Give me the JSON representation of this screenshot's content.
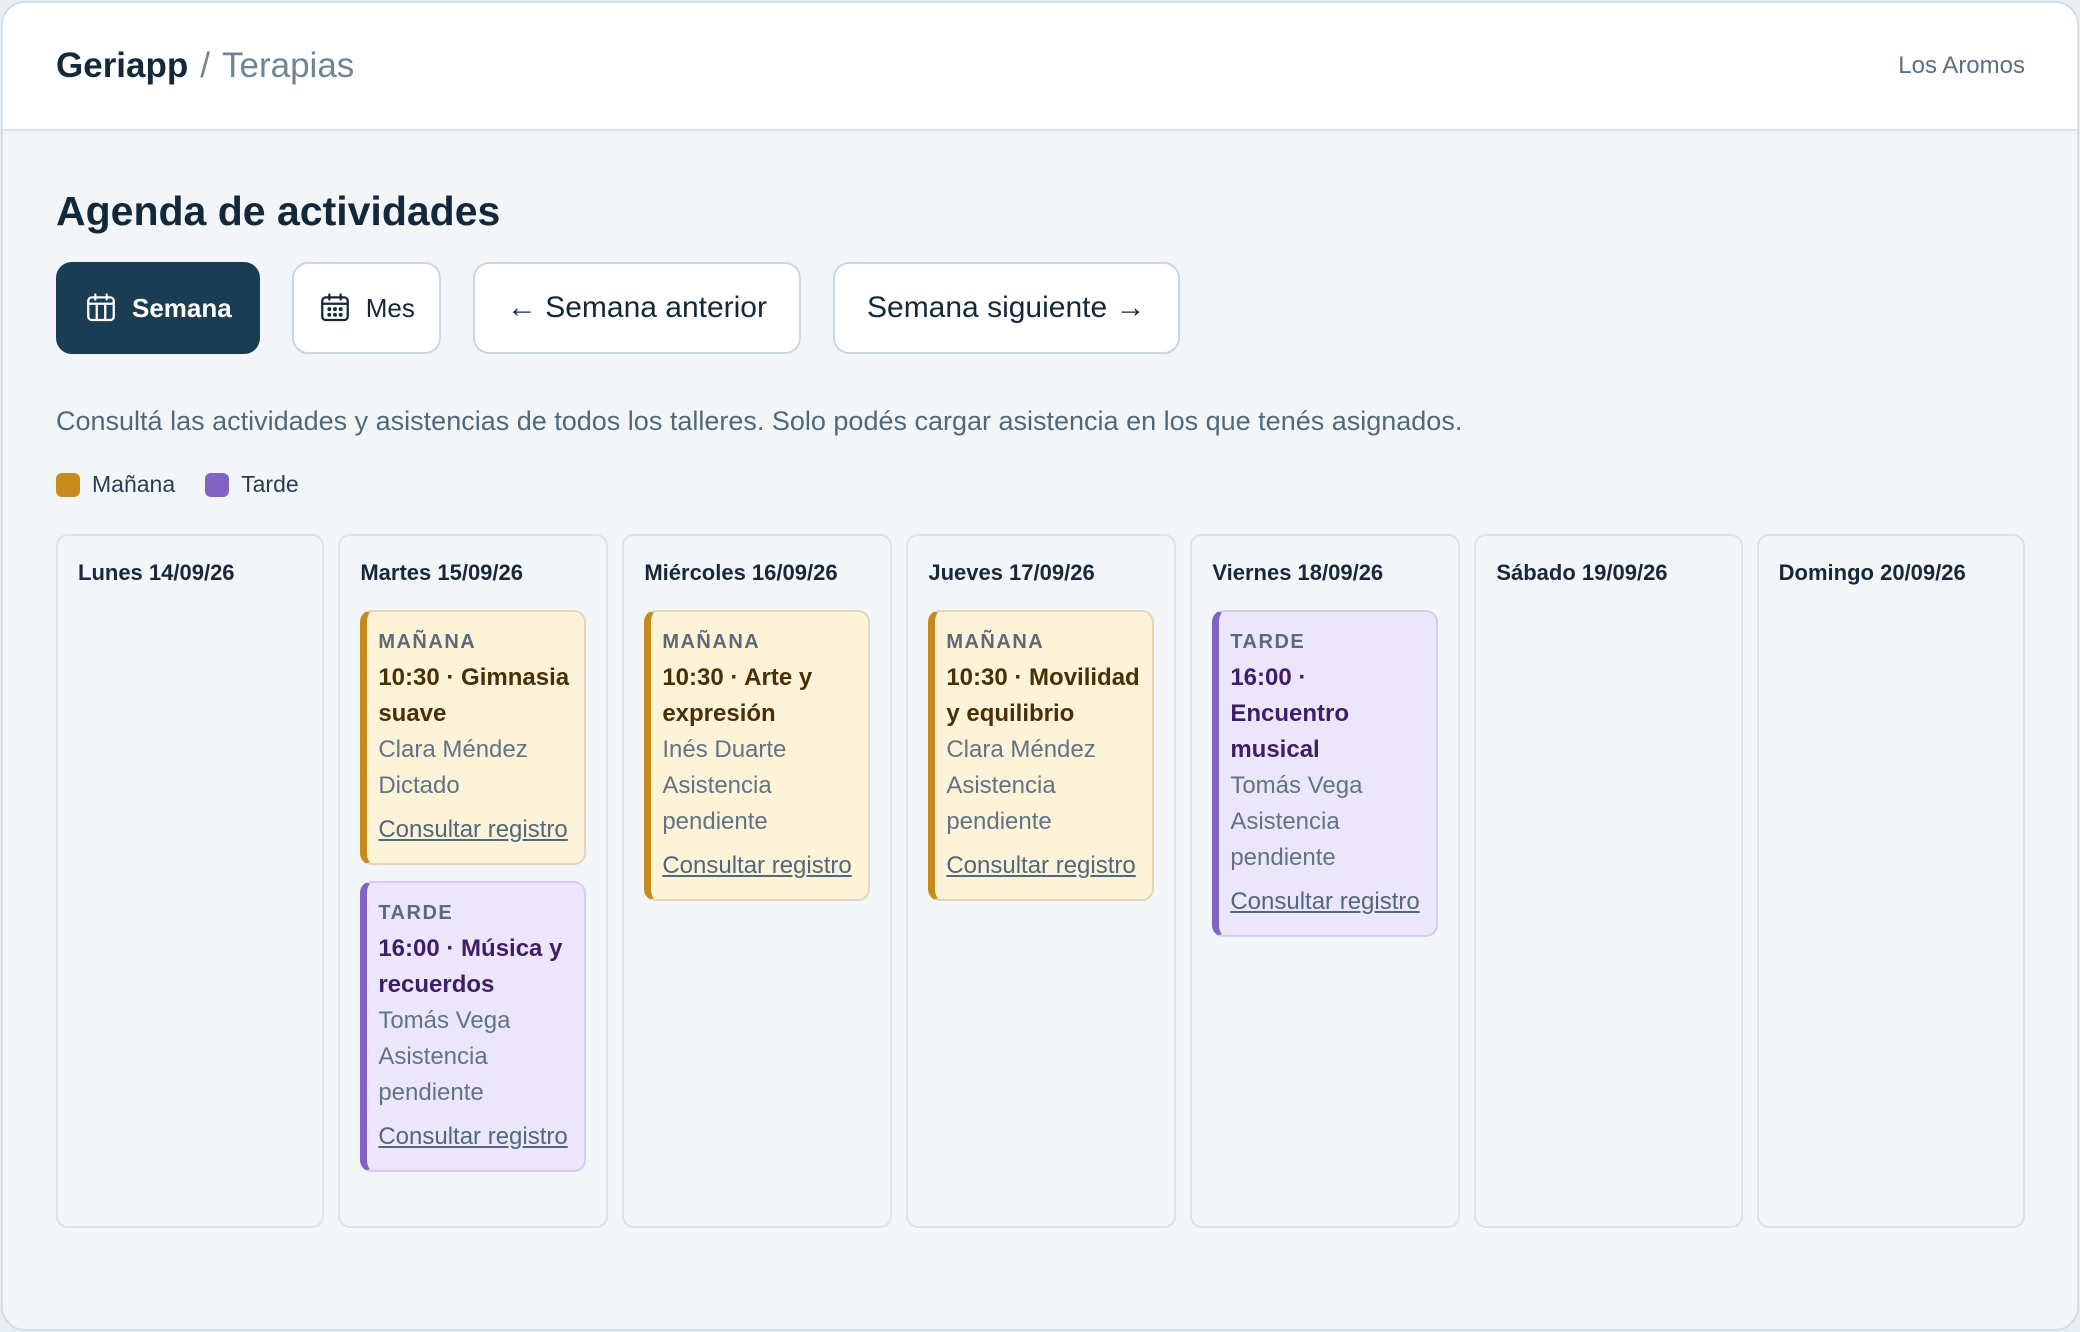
{
  "header": {
    "app_name": "Geriapp",
    "separator": "/",
    "section": "Terapias",
    "site": "Los Aromos"
  },
  "page": {
    "title": "Agenda de actividades",
    "description": "Consultá las actividades y asistencias de todos los talleres. Solo podés cargar asistencia en los que tenés asignados."
  },
  "toolbar": {
    "week_label": "Semana",
    "month_label": "Mes",
    "prev_label": "← Semana anterior",
    "next_label": "Semana siguiente →"
  },
  "legend": [
    {
      "label": "Mañana",
      "color": "#c78a1d"
    },
    {
      "label": "Tarde",
      "color": "#8063c2"
    }
  ],
  "colors": {
    "primary": "#1a3d54",
    "morning": "#c78a1d",
    "afternoon": "#8063c2"
  },
  "days": [
    {
      "label": "Lunes 14/09/26",
      "activities": []
    },
    {
      "label": "Martes 15/09/26",
      "activities": [
        {
          "shift": "MAÑANA",
          "title": "10:30 · Gimnasia suave",
          "lines": [
            "Clara Méndez",
            "Dictado"
          ],
          "link": "Consultar registro"
        },
        {
          "shift": "TARDE",
          "title": "16:00 · Música y recuerdos",
          "lines": [
            "Tomás Vega",
            "Asistencia pendiente"
          ],
          "link": "Consultar registro"
        }
      ]
    },
    {
      "label": "Miércoles 16/09/26",
      "activities": [
        {
          "shift": "MAÑANA",
          "title": "10:30 · Arte y expresión",
          "lines": [
            "Inés Duarte",
            "Asistencia pendiente"
          ],
          "link": "Consultar registro"
        }
      ]
    },
    {
      "label": "Jueves 17/09/26",
      "activities": [
        {
          "shift": "MAÑANA",
          "title": "10:30 · Movilidad y equilibrio",
          "lines": [
            "Clara Méndez",
            "Asistencia pendiente"
          ],
          "link": "Consultar registro"
        }
      ]
    },
    {
      "label": "Viernes 18/09/26",
      "activities": [
        {
          "shift": "TARDE",
          "title": "16:00 · Encuentro musical",
          "lines": [
            "Tomás Vega",
            "Asistencia pendiente"
          ],
          "link": "Consultar registro"
        }
      ]
    },
    {
      "label": "Sábado 19/09/26",
      "activities": []
    },
    {
      "label": "Domingo 20/09/26",
      "activities": []
    }
  ]
}
